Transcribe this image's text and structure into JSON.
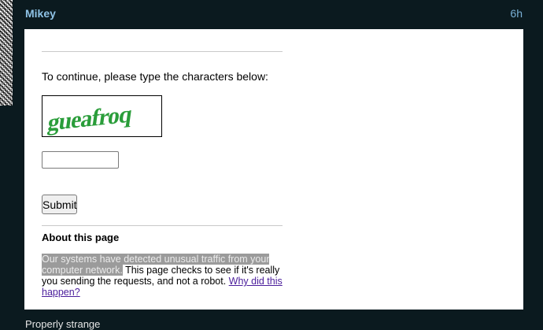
{
  "post": {
    "author": "Mikey",
    "time": "6h",
    "caption": "Properly strange"
  },
  "captcha_page": {
    "prompt": "To continue, please type the characters below:",
    "captcha_text": "gueafroq",
    "answer_value": "",
    "submit_label": "Submit",
    "about_heading": "About this page",
    "about_highlighted": "Our systems have detected unusual traffic from your computer network.",
    "about_rest": " This page checks to see if it's really you sending the requests, and not a robot. ",
    "about_link": "Why did this happen?"
  },
  "colors": {
    "background": "#0b1a1f",
    "author": "#8fc3e6",
    "captcha_green": "#2a9d3a",
    "link": "#4a1d9b"
  },
  "icons": [
    "avatar-image"
  ]
}
